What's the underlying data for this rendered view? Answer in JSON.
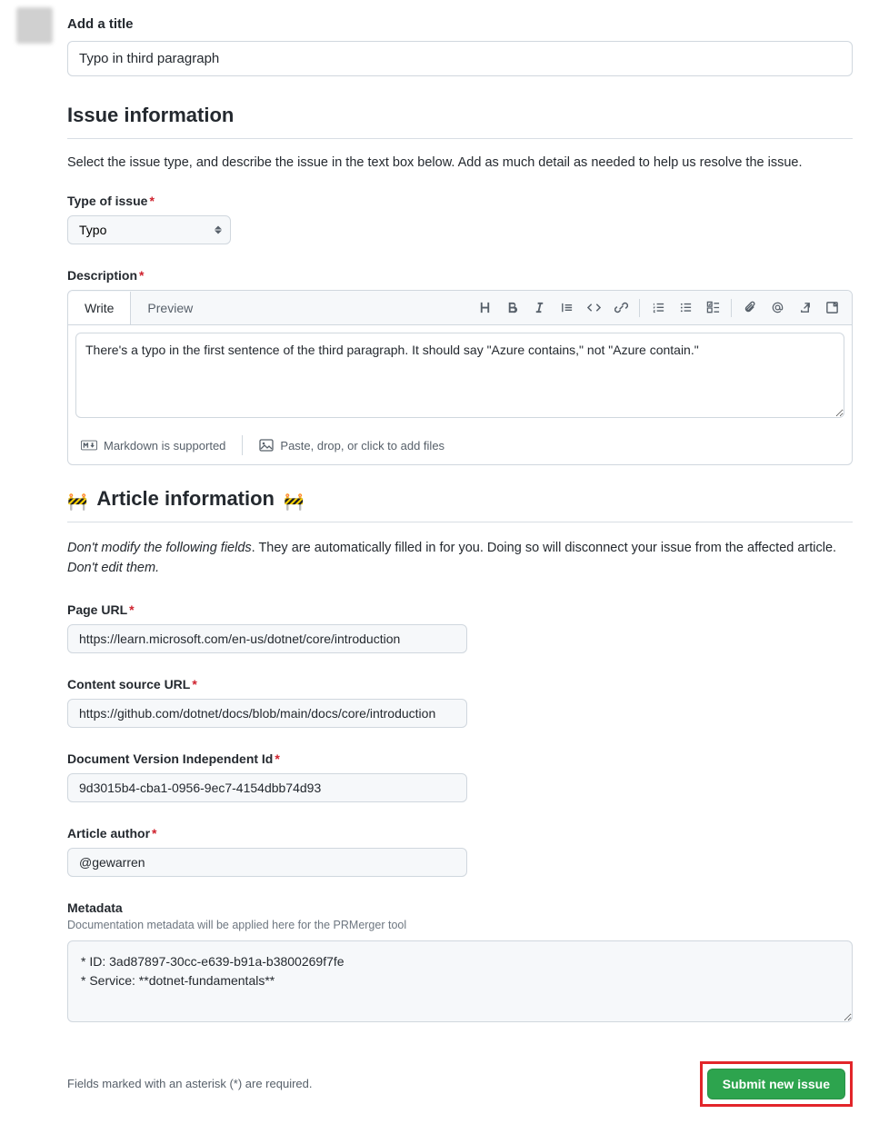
{
  "title": {
    "label": "Add a title",
    "value": "Typo in third paragraph"
  },
  "issue_info": {
    "heading": "Issue information",
    "description": "Select the issue type, and describe the issue in the text box below. Add as much detail as needed to help us resolve the issue."
  },
  "type_of_issue": {
    "label": "Type of issue",
    "selected": "Typo"
  },
  "description": {
    "label": "Description",
    "tabs": {
      "write": "Write",
      "preview": "Preview"
    },
    "value": "There's a typo in the first sentence of the third paragraph. It should say \"Azure contains,\" not \"Azure contain.\"",
    "footer": {
      "markdown": "Markdown is supported",
      "attach": "Paste, drop, or click to add files"
    }
  },
  "article_info": {
    "heading": "Article information",
    "note_prefix_em": "Don't modify the following fields",
    "note_body": ". They are automatically filled in for you. Doing so will disconnect your issue from the affected article. ",
    "note_suffix_em": "Don't edit them."
  },
  "page_url": {
    "label": "Page URL",
    "value": "https://learn.microsoft.com/en-us/dotnet/core/introduction"
  },
  "content_source_url": {
    "label": "Content source URL",
    "value": "https://github.com/dotnet/docs/blob/main/docs/core/introduction"
  },
  "doc_version_id": {
    "label": "Document Version Independent Id",
    "value": "9d3015b4-cba1-0956-9ec7-4154dbb74d93"
  },
  "article_author": {
    "label": "Article author",
    "value": "@gewarren"
  },
  "metadata": {
    "label": "Metadata",
    "hint": "Documentation metadata will be applied here for the PRMerger tool",
    "value": "* ID: 3ad87897-30cc-e639-b91a-b3800269f7fe\n* Service: **dotnet-fundamentals**"
  },
  "footer": {
    "required_note": "Fields marked with an asterisk (*) are required.",
    "submit": "Submit new issue"
  }
}
